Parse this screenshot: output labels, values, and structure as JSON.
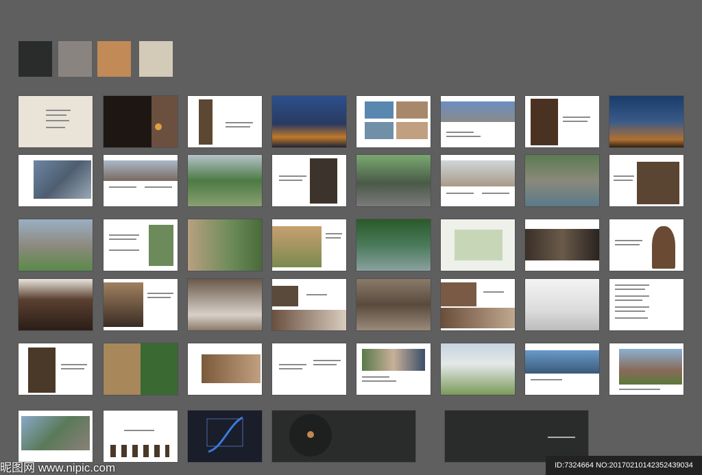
{
  "palette": {
    "swatches": [
      "#2a2b2b",
      "#8a8480",
      "#c18a56",
      "#d3cab8"
    ]
  },
  "watermark": {
    "brand": "昵图网 www.nipic.com",
    "id_label": "ID:7324664 NO:20170210142352439034"
  }
}
